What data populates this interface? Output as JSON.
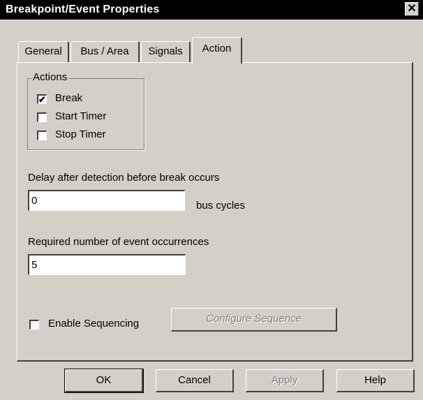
{
  "window": {
    "title": "Breakpoint/Event Properties",
    "close_glyph": "✕"
  },
  "tabs": [
    {
      "label": "General",
      "active": false
    },
    {
      "label": "Bus / Area",
      "active": false
    },
    {
      "label": "Signals",
      "active": false
    },
    {
      "label": "Action",
      "active": true
    }
  ],
  "actions_group": {
    "legend": "Actions",
    "items": [
      {
        "label": "Break",
        "checked": true
      },
      {
        "label": "Start Timer",
        "checked": false
      },
      {
        "label": "Stop Timer",
        "checked": false
      }
    ]
  },
  "delay": {
    "label": "Delay after detection before break occurs",
    "value": "0",
    "unit": "bus cycles"
  },
  "occurrences": {
    "label": "Required number of event occurrences",
    "value": "5"
  },
  "sequencing": {
    "label": "Enable Sequencing",
    "checked": false,
    "configure_label": "Configure Sequence"
  },
  "buttons": {
    "ok": "OK",
    "cancel": "Cancel",
    "apply": "Apply",
    "help": "Help"
  },
  "check_glyph": "✔"
}
